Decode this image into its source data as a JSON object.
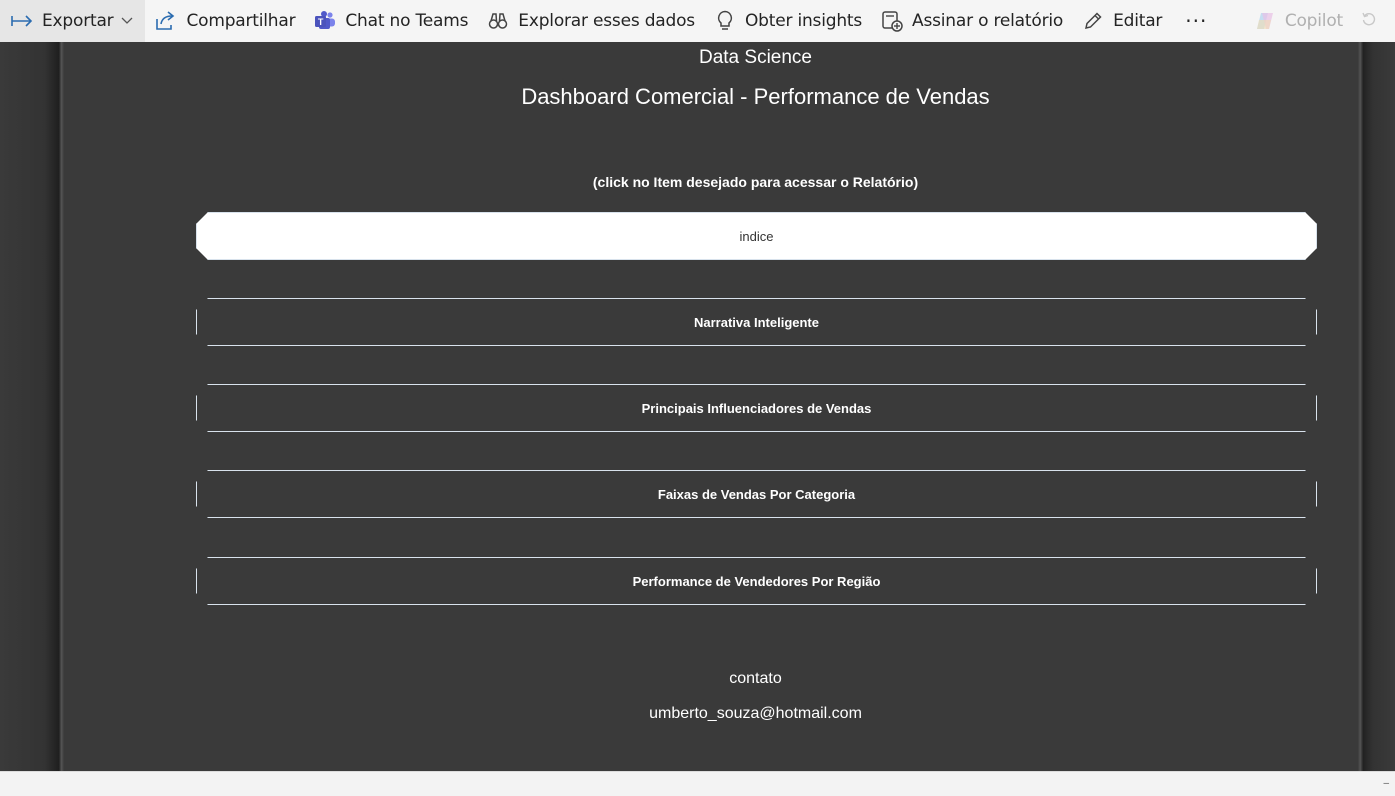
{
  "toolbar": {
    "export": "Exportar",
    "share": "Compartilhar",
    "teams": "Chat no Teams",
    "explore": "Explorar esses dados",
    "insights": "Obter insights",
    "subscribe": "Assinar o relatório",
    "edit": "Editar",
    "more": "···",
    "copilot": "Copilot"
  },
  "report": {
    "header_small": "Data Science",
    "header_title": "Dashboard Comercial - Performance de Vendas",
    "hint": "(click no Item desejado para acessar o Relatório)",
    "buttons": [
      {
        "label": "indice",
        "active": true
      },
      {
        "label": "Narrativa Inteligente",
        "active": false
      },
      {
        "label": "Principais Influenciadores de Vendas",
        "active": false
      },
      {
        "label": "Faixas de Vendas Por Categoria",
        "active": false
      },
      {
        "label": "Performance de Vendedores Por Região",
        "active": false
      }
    ],
    "contact_label": "contato",
    "contact_email": "umberto_souza@hotmail.com"
  },
  "colors": {
    "canvas_bg": "#3a3a3a",
    "button_border": "#d8e2ec",
    "active_button_bg": "#ffffff",
    "toolbar_bg": "#f5f5f5",
    "accent_icon": "#2b6cb0"
  },
  "icons": {
    "export": "export-arrow-icon",
    "share": "share-icon",
    "teams": "teams-icon",
    "explore": "binoculars-icon",
    "insights": "lightbulb-icon",
    "subscribe": "subscribe-icon",
    "edit": "pencil-icon",
    "copilot": "copilot-icon",
    "refresh": "refresh-icon"
  }
}
